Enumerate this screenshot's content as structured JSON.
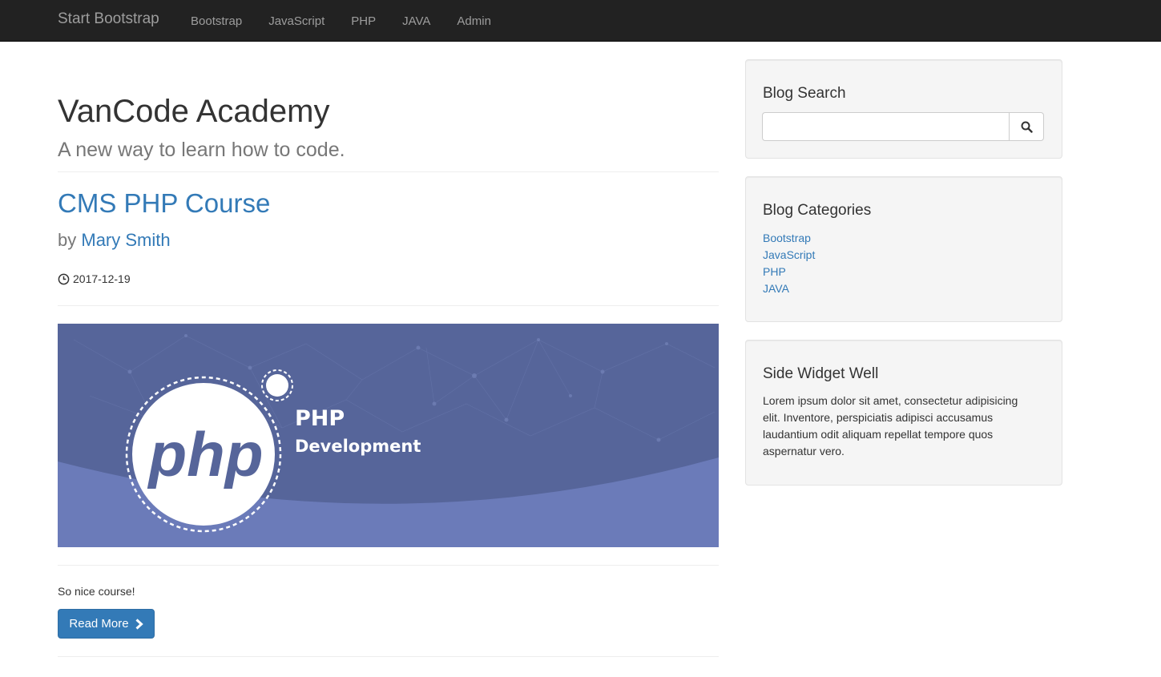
{
  "navbar": {
    "brand": "Start Bootstrap",
    "items": [
      "Bootstrap",
      "JavaScript",
      "PHP",
      "JAVA",
      "Admin"
    ]
  },
  "header": {
    "title": "VanCode Academy",
    "subtitle": "A new way to learn how to code."
  },
  "post": {
    "title": "CMS PHP Course",
    "by_label": "by",
    "author": "Mary Smith",
    "date": "2017-12-19",
    "image": {
      "heading": "PHP",
      "subheading": "Development",
      "logo_text": "php"
    },
    "excerpt": "So nice course!",
    "read_more_label": "Read More"
  },
  "sidebar": {
    "search": {
      "title": "Blog Search",
      "placeholder": "",
      "value": ""
    },
    "categories": {
      "title": "Blog Categories",
      "items": [
        "Bootstrap",
        "JavaScript",
        "PHP",
        "JAVA"
      ]
    },
    "widget": {
      "title": "Side Widget Well",
      "text": "Lorem ipsum dolor sit amet, consectetur adipisicing elit. Inventore, perspiciatis adipisci accusamus laudantium odit aliquam repellat tempore quos aspernatur vero."
    }
  },
  "icons": {
    "date": "clock-icon",
    "read_more": "chevron-right-icon",
    "search": "search-icon"
  },
  "colors": {
    "navbar_bg": "#222222",
    "link": "#337ab7",
    "button_primary": "#337ab7",
    "well_bg": "#f5f5f5",
    "image_bg": "#56659a",
    "image_wave": "#6b7bb9"
  }
}
